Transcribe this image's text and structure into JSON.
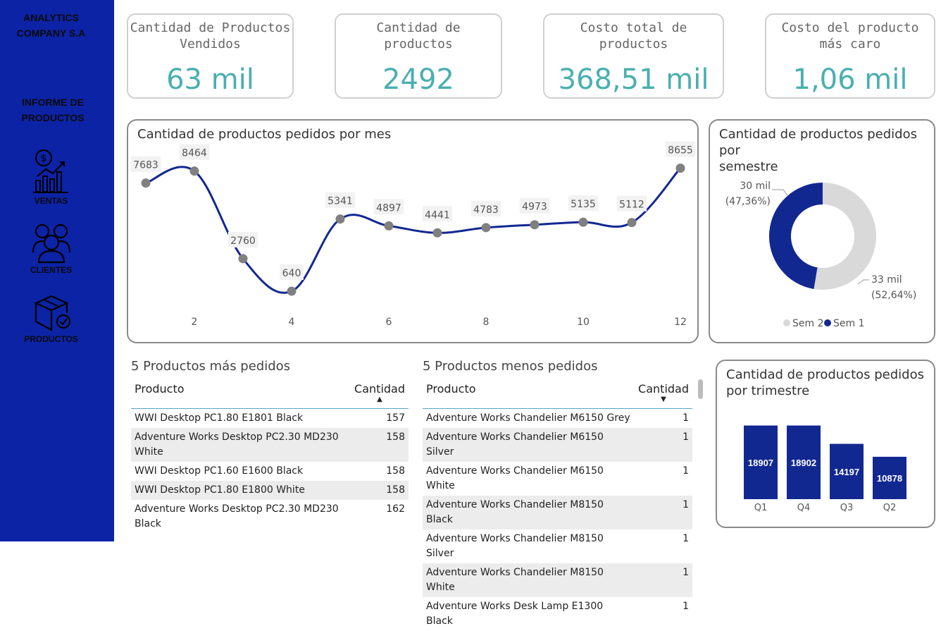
{
  "sidebar": {
    "company_line1": "ANALYTICS",
    "company_line2": "COMPANY S.A",
    "report_line1": "INFORME DE",
    "report_line2": "PRODUCTOS",
    "nav": [
      {
        "label": "VENTAS",
        "icon": "sales-chart-icon"
      },
      {
        "label": "CLIENTES",
        "icon": "customers-icon"
      },
      {
        "label": "PRODUCTOS",
        "icon": "product-box-icon"
      }
    ]
  },
  "kpis": [
    {
      "title": "Cantidad de Productos Vendidos",
      "value": "63 mil"
    },
    {
      "title": "Cantidad de productos",
      "value": "2492"
    },
    {
      "title": "Costo total de productos",
      "value": "368,51 mil"
    },
    {
      "title": "Costo del producto más caro",
      "value": "1,06 mil"
    }
  ],
  "colors": {
    "accent": "#4aafb0",
    "navy": "#0c23a6",
    "series": "#122891",
    "grey": "#d9d9d9"
  },
  "monthly": {
    "title": "Cantidad de productos pedidos por mes",
    "chart_data": {
      "type": "line",
      "x": [
        1,
        2,
        3,
        4,
        5,
        6,
        7,
        8,
        9,
        10,
        11,
        12
      ],
      "values": [
        7683,
        8464,
        2760,
        640,
        5341,
        4897,
        4441,
        4783,
        4973,
        5135,
        5112,
        8655
      ],
      "x_ticks": [
        "2",
        "4",
        "6",
        "8",
        "10",
        "12"
      ],
      "ylim": [
        0,
        9000
      ]
    }
  },
  "semester": {
    "title_line1": "Cantidad de productos pedidos por",
    "title_line2": "semestre",
    "chart_data": {
      "type": "pie",
      "slices": [
        {
          "name": "Sem 1",
          "value_label": "30 mil",
          "pct_label": "(47,36%)",
          "pct": 47.36,
          "color": "#122891"
        },
        {
          "name": "Sem 2",
          "value_label": "33 mil",
          "pct_label": "(52,64%)",
          "pct": 52.64,
          "color": "#d9d9d9"
        }
      ],
      "legend": [
        "Sem 2",
        "Sem 1"
      ]
    }
  },
  "quarter": {
    "title_line1": "Cantidad de productos pedidos",
    "title_line2": "por trimestre",
    "chart_data": {
      "type": "bar",
      "categories": [
        "Q1",
        "Q4",
        "Q3",
        "Q2"
      ],
      "values": [
        18907,
        18902,
        14197,
        10878
      ]
    }
  },
  "top5": {
    "title": "5 Productos más pedidos",
    "col_product": "Producto",
    "col_qty": "Cantidad",
    "rows": [
      {
        "product": "WWI Desktop PC1.80 E1801 Black",
        "qty": "157"
      },
      {
        "product": "Adventure Works Desktop PC2.30 MD230 White",
        "qty": "158"
      },
      {
        "product": "WWI Desktop PC1.60 E1600 Black",
        "qty": "158"
      },
      {
        "product": "WWI Desktop PC1.80 E1800 White",
        "qty": "158"
      },
      {
        "product": "Adventure Works Desktop PC2.30 MD230 Black",
        "qty": "162"
      }
    ]
  },
  "bottom5": {
    "title": "5 Productos menos pedidos",
    "col_product": "Producto",
    "col_qty": "Cantidad",
    "rows": [
      {
        "product": "Adventure Works Chandelier M6150 Grey",
        "qty": "1"
      },
      {
        "product": "Adventure Works Chandelier M6150 Silver",
        "qty": "1"
      },
      {
        "product": "Adventure Works Chandelier M6150 White",
        "qty": "1"
      },
      {
        "product": "Adventure Works Chandelier M8150 Black",
        "qty": "1"
      },
      {
        "product": "Adventure Works Chandelier M8150 Silver",
        "qty": "1"
      },
      {
        "product": "Adventure Works Chandelier M8150 White",
        "qty": "1"
      },
      {
        "product": "Adventure Works Desk Lamp E1300 Black",
        "qty": "1"
      }
    ]
  }
}
